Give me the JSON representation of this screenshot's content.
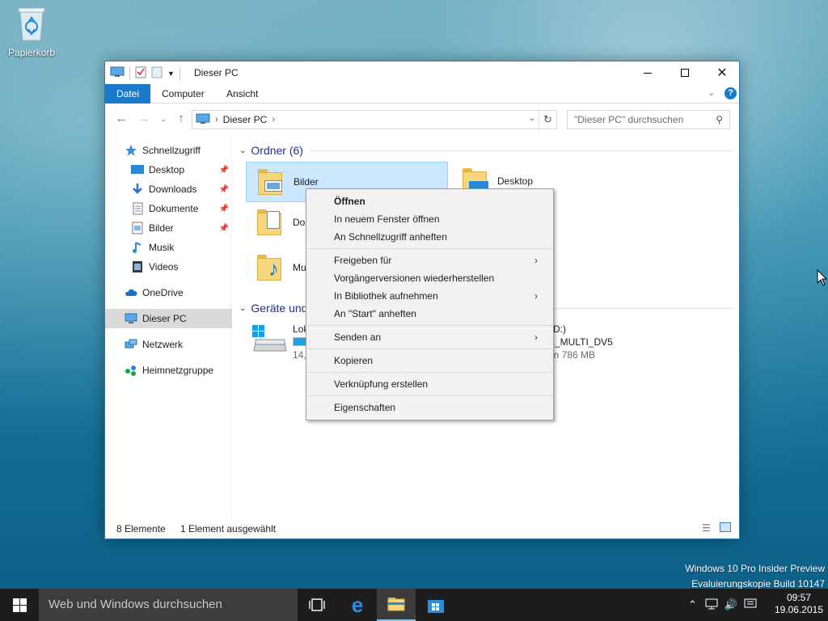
{
  "desktop": {
    "recycle_bin_label": "Papierkorb"
  },
  "window": {
    "title": "Dieser PC",
    "ribbon_tabs": [
      "Datei",
      "Computer",
      "Ansicht"
    ],
    "address": {
      "path": "Dieser PC"
    },
    "search_placeholder": "\"Dieser PC\" durchsuchen",
    "nav_items": [
      {
        "label": "Schnellzugriff",
        "icon": "star-icon"
      },
      {
        "label": "Desktop",
        "icon": "desktop-icon",
        "pinned": true
      },
      {
        "label": "Downloads",
        "icon": "download-icon",
        "pinned": true
      },
      {
        "label": "Dokumente",
        "icon": "documents-icon",
        "pinned": true
      },
      {
        "label": "Bilder",
        "icon": "pictures-icon",
        "pinned": true
      },
      {
        "label": "Musik",
        "icon": "music-icon"
      },
      {
        "label": "Videos",
        "icon": "videos-icon"
      },
      {
        "label": "OneDrive",
        "icon": "cloud-icon"
      },
      {
        "label": "Dieser PC",
        "icon": "pc-icon",
        "selected": true
      },
      {
        "label": "Netzwerk",
        "icon": "network-icon"
      },
      {
        "label": "Heimnetzgruppe",
        "icon": "homegroup-icon"
      }
    ],
    "groups": {
      "folders_header": "Ordner (6)",
      "devices_header": "Geräte und",
      "folders": [
        {
          "label": "Bilder",
          "selected": true
        },
        {
          "label": "Desktop"
        },
        {
          "label": "Dok"
        },
        {
          "label": "Mu"
        }
      ],
      "devices": [
        {
          "label": "Lok",
          "sub": "14,",
          "fill": 0.3
        },
        {
          "label": "(D:)",
          "line2": "E_MULTI_DV5",
          "sub": "on 786 MB"
        }
      ]
    },
    "status": {
      "count": "8 Elemente",
      "selection": "1 Element ausgewählt"
    }
  },
  "context_menu": {
    "items": [
      {
        "label": "Öffnen",
        "bold": true
      },
      {
        "label": "In neuem Fenster öffnen"
      },
      {
        "label": "An Schnellzugriff anheften"
      },
      {
        "label": "Freigeben für",
        "submenu": true
      },
      {
        "label": "Vorgängerversionen wiederherstellen"
      },
      {
        "label": "In Bibliothek aufnehmen",
        "submenu": true
      },
      {
        "label": "An \"Start\" anheften"
      },
      {
        "label": "Senden an",
        "submenu": true
      },
      {
        "label": "Kopieren"
      },
      {
        "label": "Verknüpfung erstellen"
      },
      {
        "label": "Eigenschaften"
      }
    ]
  },
  "watermark": {
    "line1": "Windows 10 Pro Insider Preview",
    "line2": "Evaluierungskopie Build 10147"
  },
  "taskbar": {
    "search_placeholder": "Web und Windows durchsuchen",
    "time": "09:57",
    "date": "19.06.2015"
  },
  "colors": {
    "accent": "#1979ca",
    "selection": "#cce8ff",
    "taskbar": "#1d1d1d"
  }
}
